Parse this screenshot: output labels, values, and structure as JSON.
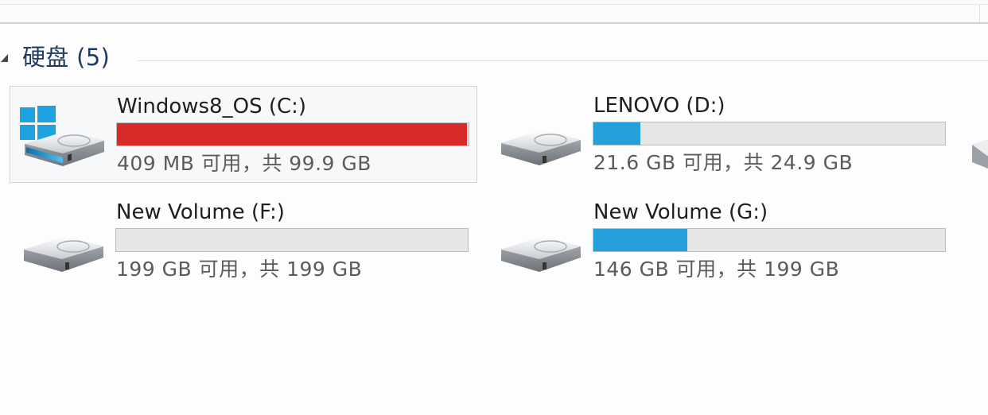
{
  "group": {
    "title": "硬盘 (5)"
  },
  "drives": [
    {
      "name": "Windows8_OS (C:)",
      "free_text": "409 MB 可用，共 99.9 GB",
      "used_fraction": 0.996,
      "bar_color": "#d92a2a",
      "icon": "windows-drive-icon"
    },
    {
      "name": "LENOVO (D:)",
      "free_text": "21.6 GB 可用，共 24.9 GB",
      "used_fraction": 0.133,
      "bar_color": "#26a0da",
      "icon": "hard-drive-icon"
    },
    {
      "name": "New Volume (F:)",
      "free_text": "199 GB 可用，共 199 GB",
      "used_fraction": 0.0,
      "bar_color": "#26a0da",
      "icon": "hard-drive-icon"
    },
    {
      "name": "New Volume (G:)",
      "free_text": "146 GB 可用，共 199 GB",
      "used_fraction": 0.266,
      "bar_color": "#26a0da",
      "icon": "hard-drive-icon"
    }
  ]
}
